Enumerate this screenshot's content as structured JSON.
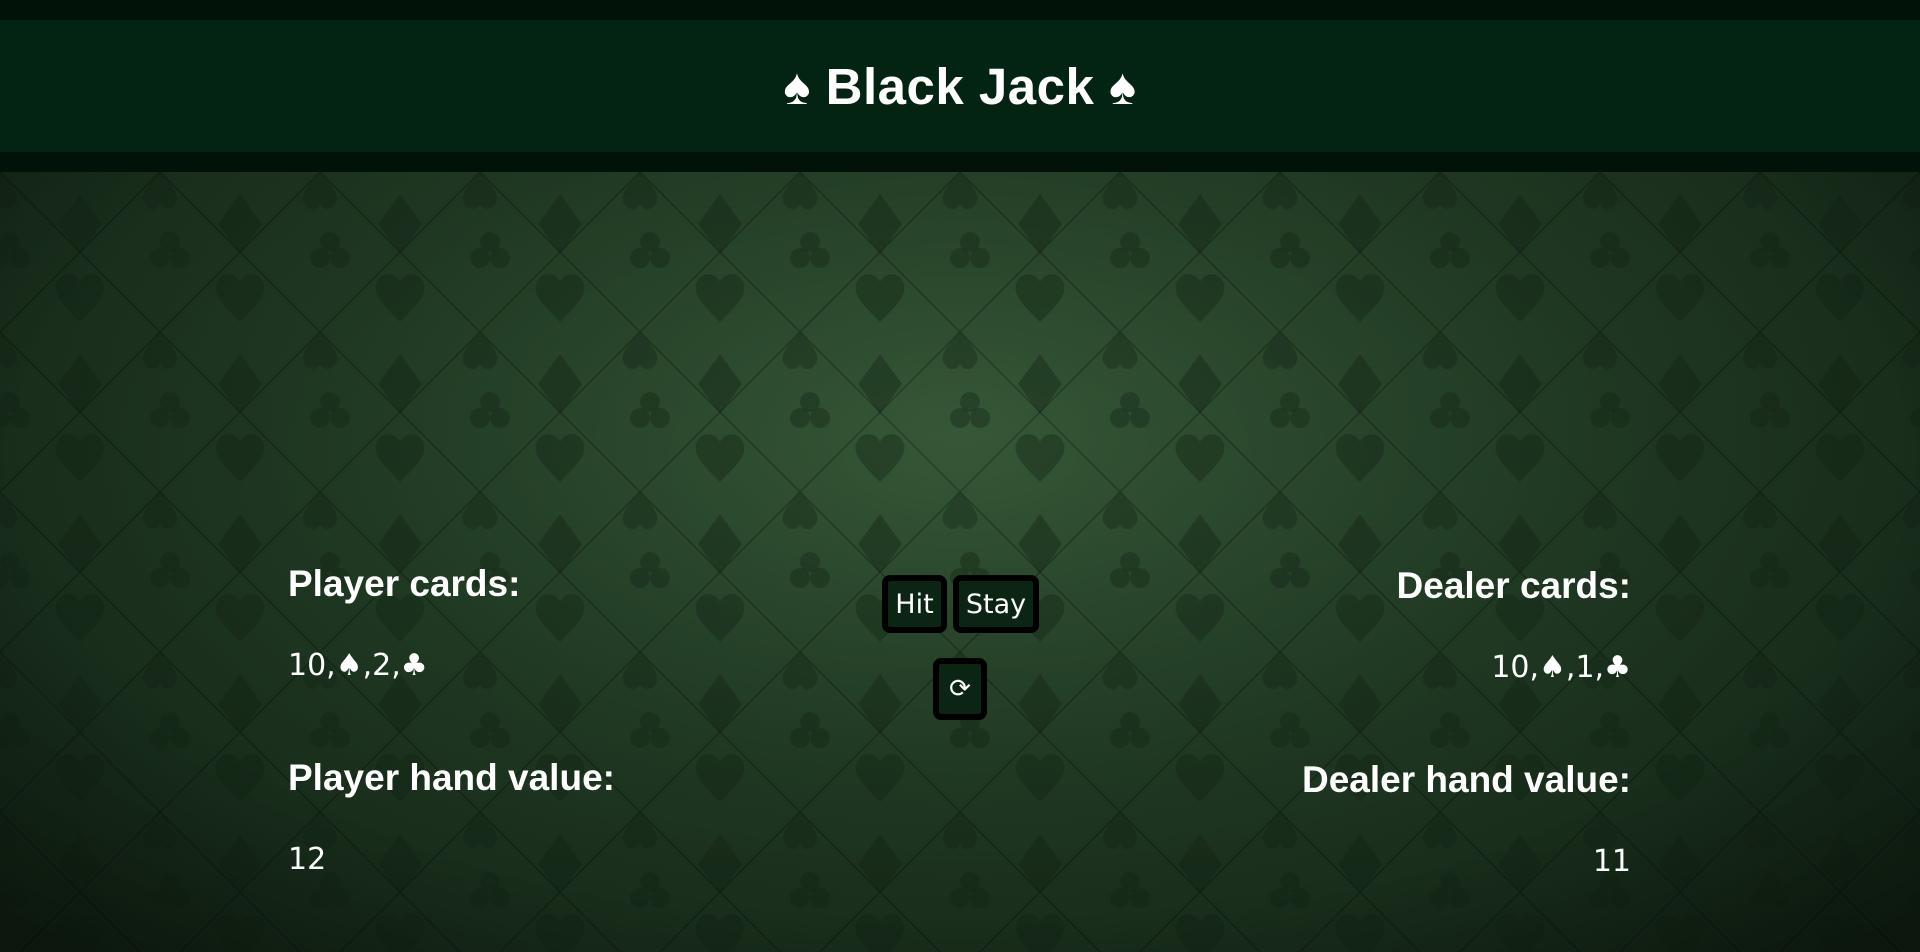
{
  "header": {
    "title": "♠ Black Jack ♠"
  },
  "player": {
    "cards_label": "Player cards:",
    "cards": "10,♠,2,♣",
    "hand_value_label": "Player hand value:",
    "hand_value": "12"
  },
  "dealer": {
    "cards_label": "Dealer cards:",
    "cards": "10,♠,1,♣",
    "hand_value_label": "Dealer hand value:",
    "hand_value": "11"
  },
  "controls": {
    "hit_label": "Hit",
    "stay_label": "Stay",
    "restart_label": "⟳"
  },
  "colors": {
    "header_outer": "#011208",
    "header_inner": "#032413",
    "table_felt": "#223d26",
    "button_bg": "#0b2414",
    "button_border": "#000000",
    "text": "#ffffff"
  }
}
